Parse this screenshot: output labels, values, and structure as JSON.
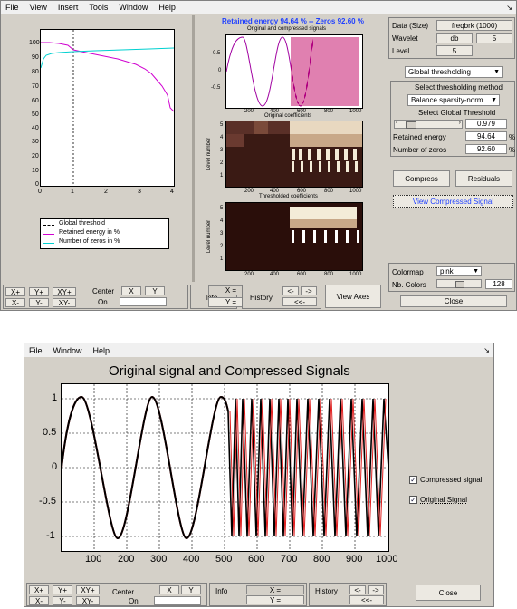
{
  "top": {
    "menu": [
      "File",
      "View",
      "Insert",
      "Tools",
      "Window",
      "Help"
    ],
    "left_legend": [
      "Global threshold",
      "Retained energy in %",
      "Number of zeros in %"
    ],
    "left_ticks_y": [
      "100",
      "90",
      "80",
      "70",
      "60",
      "50",
      "40",
      "30",
      "20",
      "10",
      "0"
    ],
    "left_ticks_x": [
      "0",
      "1",
      "2",
      "3",
      "4"
    ],
    "title": "Retained energy 94.64 % -- Zeros 92.60 %",
    "sub1": "Original and compressed signals",
    "sub2": "Original coefficients",
    "sub3": "Thresholded coefficients",
    "signal_ticks_y": [
      "0.5",
      "0",
      "-0.5"
    ],
    "x_ticks": [
      "200",
      "400",
      "600",
      "800",
      "1000"
    ],
    "coef_ticks_y": [
      "5",
      "4",
      "3",
      "2",
      "1"
    ],
    "level_number": "Level number",
    "data_label": "Data  (Size)",
    "data_value": "freqbrk  (1000)",
    "wavelet_label": "Wavelet",
    "wavelet_name": "db",
    "wavelet_order": "5",
    "level_label": "Level",
    "level_value": "5",
    "threshold_mode": "Global thresholding",
    "method_title": "Select thresholding method",
    "method_value": "Balance sparsity-norm",
    "global_thr_title": "Select Global Threshold",
    "thr_value": "0.979",
    "retained_label": "Retained energy",
    "retained_value": "94.64",
    "zeros_label": "Number of zeros",
    "zeros_value": "92.60",
    "pct": "%",
    "compress": "Compress",
    "residuals": "Residuals",
    "view_compressed": "View Compressed Signal",
    "colormap_label": "Colormap",
    "colormap_value": "pink",
    "nbcolors_label": "Nb. Colors",
    "nbcolors_value": "128",
    "close": "Close",
    "bottom": {
      "xp": "X+",
      "yp": "Y+",
      "xyp": "XY+",
      "xm": "X-",
      "ym": "Y-",
      "xym": "XY-",
      "center": "Center",
      "on": "On",
      "x": "X",
      "y": "Y",
      "info": "Info",
      "xeq": "X =",
      "yeq": "Y =",
      "history": "History",
      "hl": "<-",
      "hr": "->",
      "hb": "<<-",
      "view_axes": "View Axes"
    }
  },
  "bottom_win": {
    "menu": [
      "File",
      "Window",
      "Help"
    ],
    "title": "Original signal and Compressed Signals",
    "y_ticks": [
      "1",
      "0.5",
      "0",
      "-0.5",
      "-1"
    ],
    "x_ticks": [
      "100",
      "200",
      "300",
      "400",
      "500",
      "600",
      "700",
      "800",
      "900",
      "1000"
    ],
    "cb1": "Compressed signal",
    "cb2": "Original Signal",
    "close": "Close",
    "bottom": {
      "xp": "X+",
      "yp": "Y+",
      "xyp": "XY+",
      "xm": "X-",
      "ym": "Y-",
      "xym": "XY-",
      "center": "Center",
      "on": "On",
      "x": "X",
      "y": "Y",
      "info": "Info",
      "xeq": "X =",
      "yeq": "Y =",
      "history": "History",
      "hl": "<-",
      "hr": "->",
      "hb": "<<-"
    }
  },
  "colors": {
    "energy": "#d000d0",
    "zeros": "#00d0d0",
    "title": "#2040ff",
    "compressed": "#e02020"
  }
}
